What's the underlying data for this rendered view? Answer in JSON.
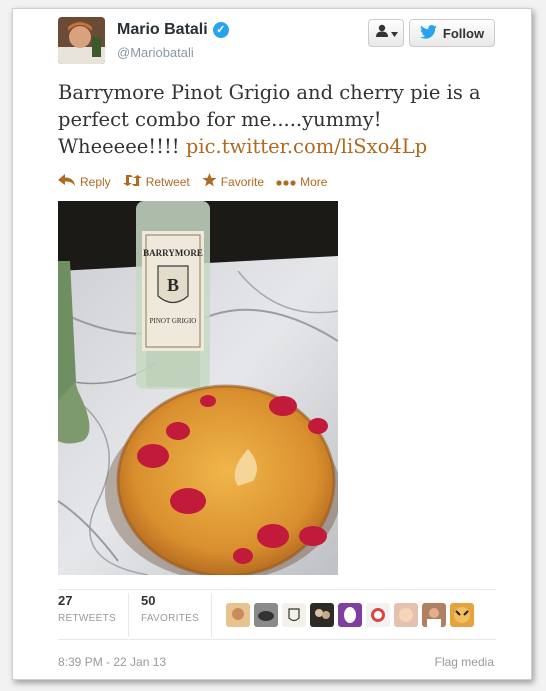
{
  "header": {
    "name": "Mario Batali",
    "handle": "@Mariobatali",
    "follow_label": "Follow"
  },
  "tweet": {
    "text": "Barrymore Pinot Grigio and cherry pie is a perfect combo for me.....yummy! Wheeeee!!!! ",
    "link": "pic.twitter.com/liSxo4Lp"
  },
  "actions": {
    "reply": "Reply",
    "retweet": "Retweet",
    "favorite": "Favorite",
    "more": "More"
  },
  "photo": {
    "label_brand": "BARRYMORE",
    "label_monogram": "B",
    "label_variety": "PINOT GRIGIO"
  },
  "stats": {
    "retweets_count": "27",
    "retweets_label": "RETWEETS",
    "favorites_count": "50",
    "favorites_label": "FAVORITES"
  },
  "footer": {
    "timestamp": "8:39 PM - 22 Jan 13",
    "flag_label": "Flag media"
  },
  "colors": {
    "link": "#b06a20",
    "verified": "#2aa3ef",
    "follow_bird": "#2aa3ef"
  }
}
